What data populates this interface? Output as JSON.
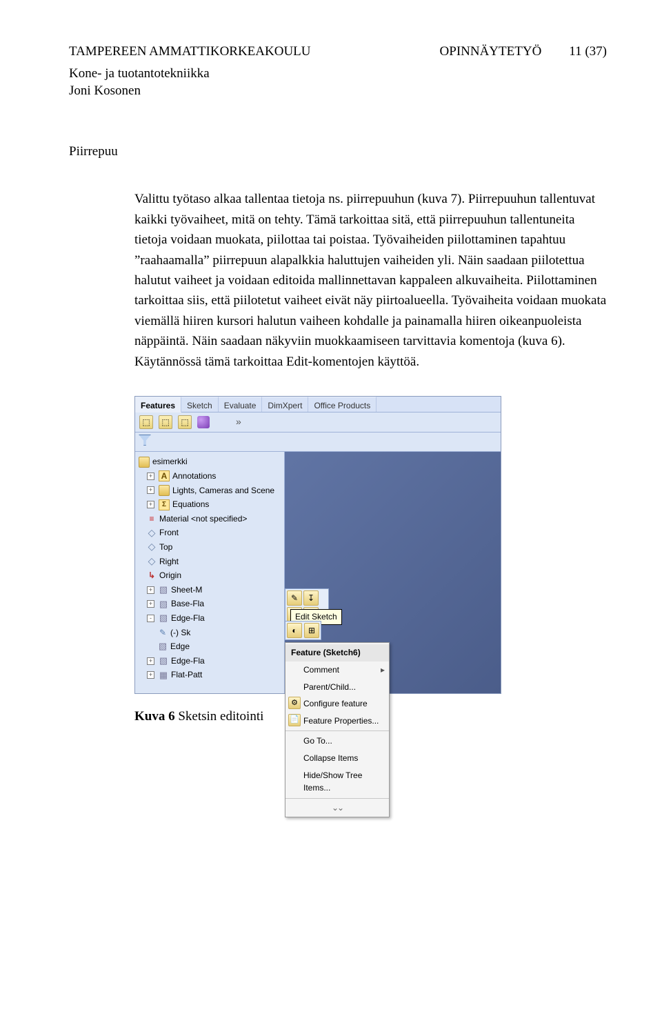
{
  "header": {
    "left": "TAMPEREEN AMMATTIKORKEAKOULU",
    "center": "OPINNÄYTETYÖ",
    "page": "11 (37)",
    "sub1": "Kone- ja tuotantotekniikka",
    "sub2": "Joni Kosonen"
  },
  "section_title": "Piirrepuu",
  "body": "Valittu työtaso alkaa tallentaa tietoja ns. piirrepuuhun (kuva 7). Piirrepuuhun tallentuvat kaikki työvaiheet, mitä on tehty. Tämä tarkoittaa sitä, että piirrepuuhun tallentuneita tietoja voidaan muokata, piilottaa tai poistaa. Työvaiheiden piilottaminen tapahtuu ”raahaamalla” piirrepuun alapalkkia haluttujen vaiheiden yli. Näin saadaan piilotettua halutut vaiheet ja voidaan editoida mallinnettavan kappaleen alkuvaiheita. Piilottaminen tarkoittaa siis, että piilotetut vaiheet eivät näy piirtoalueella. Työvaiheita voidaan muokata viemällä hiiren kursori halutun vaiheen kohdalle ja painamalla hiiren oikeanpuoleista näppäintä. Näin saadaan näkyviin muokkaamiseen tarvittavia komentoja (kuva 6). Käytännössä tämä tarkoittaa Edit-komentojen käyttöä.",
  "cad": {
    "tabs": [
      "Features",
      "Sketch",
      "Evaluate",
      "DimXpert",
      "Office Products"
    ],
    "tree": {
      "root": "esimerkki",
      "items": [
        "Annotations",
        "Lights, Cameras and Scene",
        "Equations",
        "Material <not specified>",
        "Front",
        "Top",
        "Right",
        "Origin",
        "Sheet-M",
        "Base-Fla",
        "Edge-Fla",
        "(-) Sk",
        "Edge",
        "Edge-Fla",
        "Flat-Patt"
      ]
    },
    "tooltip": "Edit Sketch",
    "ctx": {
      "title": "Feature (Sketch6)",
      "items": [
        "Comment",
        "Parent/Child...",
        "Configure feature",
        "Feature Properties...",
        "Go To...",
        "Collapse Items",
        "Hide/Show Tree Items..."
      ]
    },
    "expand": "»"
  },
  "caption_bold": "Kuva 6",
  "caption_rest": " Sketsin editointi"
}
